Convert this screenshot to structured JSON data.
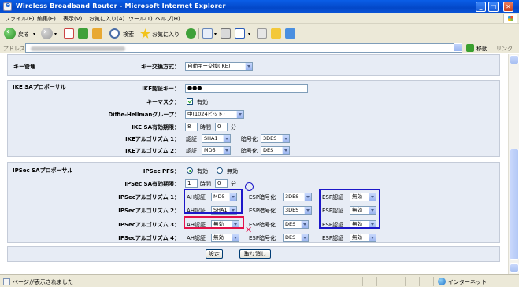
{
  "window": {
    "title": "Wireless Broadband Router - Microsoft Internet Explorer",
    "min": "_",
    "max": "□",
    "close": "✕"
  },
  "menu": [
    "ファイル(F)",
    "編集(E)",
    "表示(V)",
    "お気に入り(A)",
    "ツール(T)",
    "ヘルプ(H)"
  ],
  "toolbar": {
    "back": "戻る",
    "search": "検索",
    "favorites": "お気に入り"
  },
  "address": {
    "label": "アドレス(D)",
    "go": "移動",
    "links": "リンク"
  },
  "key_mgmt": {
    "heading": "キー管理",
    "method_label": "キー交換方式：",
    "method_value": "自動キー交換(IKE)"
  },
  "ike": {
    "heading": "IKE SAプロポーサル",
    "auth_key_label": "IKE認証キー：",
    "auth_key_value": "●●●",
    "key_mask_label": "キーマスク：",
    "key_mask_text": "有効",
    "dh_label": "Diffie-Hellmanグループ：",
    "dh_value": "中(1024ビット)",
    "lifetime_label": "IKE SA有効期限：",
    "lifetime_hours": "8",
    "hours_unit": "時間",
    "lifetime_minutes": "0",
    "minutes_unit": "分",
    "algo1_label": "IKEアルゴリズム 1：",
    "algo2_label": "IKEアルゴリズム 2：",
    "auth_text": "認証",
    "enc_text": "暗号化",
    "algo1_auth": "SHA1",
    "algo1_enc": "3DES",
    "algo2_auth": "MD5",
    "algo2_enc": "DES"
  },
  "ipsec": {
    "heading": "IPSec SAプロポーサル",
    "pfs_label": "IPSec PFS：",
    "pfs_on": "有効",
    "pfs_off": "無効",
    "lifetime_label": "IPSec SA有効期限：",
    "lifetime_hours": "1",
    "hours_unit": "時間",
    "lifetime_minutes": "0",
    "minutes_unit": "分",
    "ah_auth_text": "AH認証",
    "esp_enc_text": "ESP暗号化",
    "esp_auth_text": "ESP認証",
    "rows": [
      {
        "label": "IPSecアルゴリズム 1：",
        "ah": "MD5",
        "esp_enc": "3DES",
        "esp_auth": "無効"
      },
      {
        "label": "IPSecアルゴリズム 2：",
        "ah": "SHA1",
        "esp_enc": "3DES",
        "esp_auth": "無効"
      },
      {
        "label": "IPSecアルゴリズム 3：",
        "ah": "無効",
        "esp_enc": "DES",
        "esp_auth": "無効"
      },
      {
        "label": "IPSecアルゴリズム 4：",
        "ah": "無効",
        "esp_enc": "DES",
        "esp_auth": "無効"
      }
    ]
  },
  "buttons": {
    "set": "設定",
    "cancel": "取り消し"
  },
  "status": {
    "message": "ページが表示されました",
    "zone": "インターネット"
  },
  "annotations": {
    "circle": "○",
    "cross": "✕"
  },
  "colors": {
    "highlight_blue": "#1c17c9",
    "highlight_red": "#e4124a",
    "panel_bg": "#e7ecf5"
  }
}
